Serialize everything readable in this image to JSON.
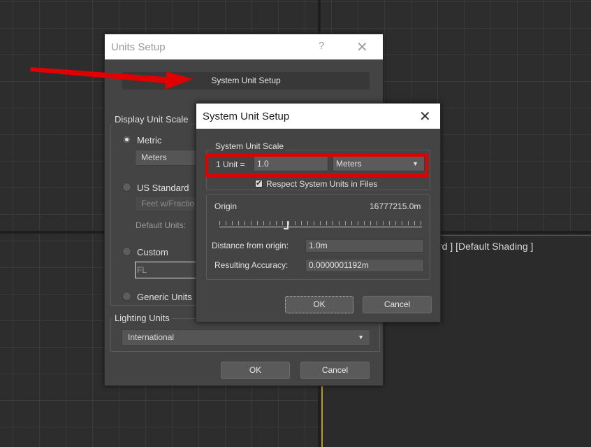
{
  "viewport": {
    "label": "rd ] [Default Shading ]"
  },
  "units_setup": {
    "title": "Units Setup",
    "help_icon": "?",
    "close_icon": "✕",
    "system_unit_setup_button": "System Unit Setup",
    "display_unit_scale_label": "Display Unit Scale",
    "metric_label": "Metric",
    "metric_value": "Meters",
    "us_standard_label": "US Standard",
    "us_standard_value": "Feet w/Fractio",
    "default_units_label": "Default Units:",
    "custom_label": "Custom",
    "custom_value": "FL",
    "generic_units_label": "Generic Units",
    "lighting_units_label": "Lighting Units",
    "lighting_units_value": "International",
    "ok_label": "OK",
    "cancel_label": "Cancel",
    "selected_scale": "Metric"
  },
  "system_unit_setup": {
    "title": "System Unit Setup",
    "close_icon": "✕",
    "scale_group_label": "System Unit Scale",
    "unit_equals_label": "1 Unit =",
    "unit_value": "1.0",
    "unit_type": "Meters",
    "respect_checkbox_label": "Respect System Units in Files",
    "respect_checked": true,
    "origin_label": "Origin",
    "origin_value": "16777215.0m",
    "distance_label": "Distance from origin:",
    "distance_value": "1.0m",
    "accuracy_label": "Resulting Accuracy:",
    "accuracy_value": "0.0000001192m",
    "ok_label": "OK",
    "cancel_label": "Cancel"
  },
  "colors": {
    "dialog_bg": "#444444",
    "highlight_red": "#e00000",
    "viewport_border": "#b8962e"
  }
}
